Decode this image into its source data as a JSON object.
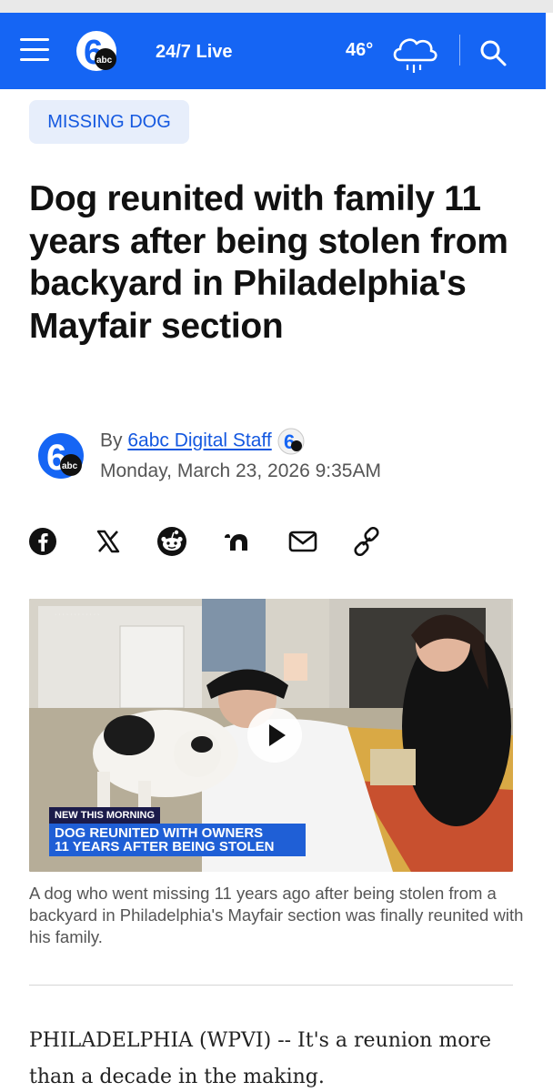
{
  "header": {
    "live_label": "24/7 Live",
    "temperature": "46°",
    "weather_icon": "rain-cloud-icon",
    "brand_color": "#1565f4"
  },
  "article": {
    "category_tag": "MISSING DOG",
    "headline": "Dog reunited with family 11 years after being stolen from backyard in Philadelphia's Mayfair section",
    "byline_prefix": "By ",
    "author": "6abc Digital Staff",
    "date": "Monday, March 23, 2026 9:35AM",
    "share_icons": [
      "facebook-icon",
      "x-icon",
      "reddit-icon",
      "nextdoor-icon",
      "email-icon",
      "link-icon"
    ],
    "media": {
      "lower_third_kicker": "NEW THIS MORNING",
      "lower_third_line1": "DOG REUNITED WITH OWNERS",
      "lower_third_line2": "11 YEARS AFTER BEING STOLEN"
    },
    "caption": "A dog who went missing 11 years ago after being stolen from a backyard in Philadelphia's Mayfair section was finally reunited with his family.",
    "body_first_paragraph": "PHILADELPHIA (WPVI) -- It's a reunion more than a decade in the making."
  }
}
